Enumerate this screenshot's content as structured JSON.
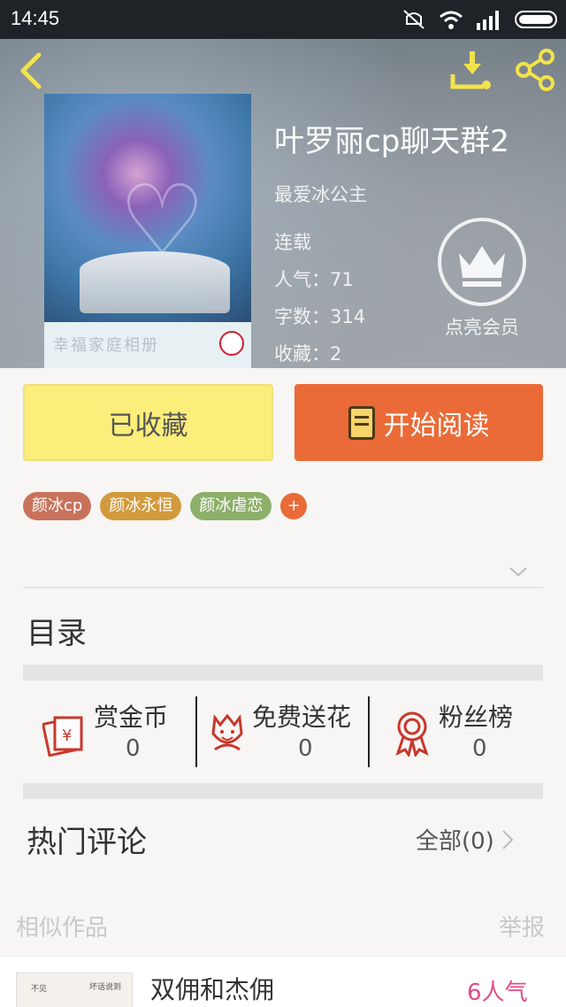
{
  "status_bar": {
    "time": "14:45"
  },
  "book": {
    "title": "叶罗丽cp聊天群2",
    "author": "最爱冰公主",
    "status": "连载",
    "popularity": "人气：71",
    "words": "字数：314",
    "favorites": "收藏：2",
    "cover_text": "幸福家庭相册"
  },
  "vip": {
    "label": "点亮会员"
  },
  "actions": {
    "collected": "已收藏",
    "start_reading": "开始阅读"
  },
  "tags": [
    {
      "label": "颜冰cp",
      "color": "#c8725c"
    },
    {
      "label": "颜冰永恒",
      "color": "#d29a3c"
    },
    {
      "label": "颜冰虐恋",
      "color": "#8cb06a"
    }
  ],
  "tag_add": "+",
  "toc": {
    "title": "目录"
  },
  "stats": [
    {
      "name": "赏金币",
      "value": "0",
      "icon": "red-envelope-icon"
    },
    {
      "name": "免费送花",
      "value": "0",
      "icon": "flower-icon"
    },
    {
      "name": "粉丝榜",
      "value": "0",
      "icon": "medal-icon"
    }
  ],
  "comments": {
    "title": "热门评论",
    "all": "全部(0)"
  },
  "similar": {
    "title": "相似作品",
    "report": "举报",
    "items": [
      {
        "name": "双佣和杰佣",
        "popularity": "6人气",
        "thumb_text_1": "不见",
        "thumb_text_2": "坏话说到"
      }
    ]
  },
  "colors": {
    "accent": "#ea6b37",
    "collected": "#fbee7a",
    "popularity": "#e14c86"
  }
}
